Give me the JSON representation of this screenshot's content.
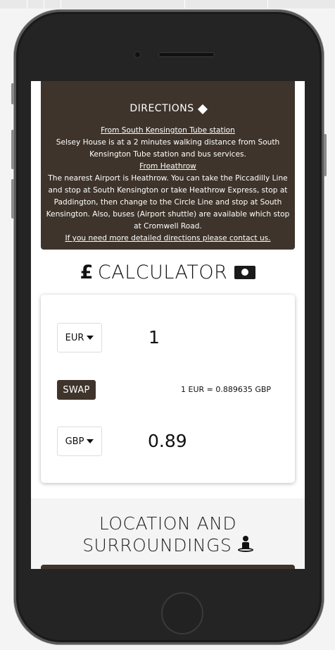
{
  "directions": {
    "title": "DIRECTIONS",
    "title_icon": "directions-diamond-icon",
    "tube_link": "From South Kensington Tube station",
    "tube_text": "Selsey House is at a 2 minutes walking distance from South Kensington Tube station and bus services.",
    "heathrow_link": "From Heathrow",
    "heathrow_text": "The nearest Airport is Heathrow. You can take the Piccadilly Line and stop at South Kensington or take Heathrow Express, stop at Paddington, then change to the Circle Line and stop at South Kensington. Also, buses (Airport shuttle) are available which stop at Cromwell Road.",
    "contact_link": "If you need more detailed directions please contact us."
  },
  "calculator": {
    "title": "CALCULATOR",
    "title_icon_left": "pound-sign-icon",
    "title_icon_right": "money-bill-icon",
    "from_currency": "EUR",
    "from_amount": "1",
    "swap_label": "SWAP",
    "rate_text": "1 EUR = 0.889635 GBP",
    "to_currency": "GBP",
    "to_amount": "0.89"
  },
  "location": {
    "title_line1": "LOCATION AND",
    "title_line2": "SURROUNDINGS",
    "title_icon": "street-view-icon"
  },
  "colors": {
    "brand_brown": "#3e342b",
    "phone_body": "#242424"
  }
}
